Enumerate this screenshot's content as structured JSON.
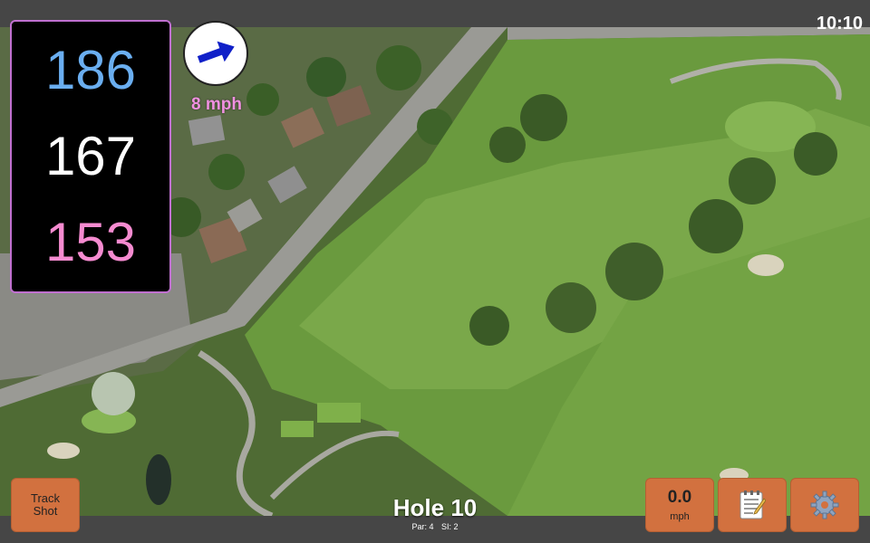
{
  "status_bar": {
    "time": "10:10"
  },
  "distances": {
    "back": "186",
    "middle": "167",
    "front": "153",
    "colors": {
      "back": "#6aaef0",
      "middle": "#ffffff",
      "front": "#f58bd0"
    }
  },
  "wind": {
    "label": "8 mph",
    "arrow_icon": "wind-direction-arrow-icon",
    "arrow_color": "#1020c8",
    "label_color": "#f090e0"
  },
  "hole": {
    "title": "Hole 10",
    "par": "Par: 4",
    "si": "SI: 2"
  },
  "buttons": {
    "track_shot_line1": "Track",
    "track_shot_line2": "Shot",
    "wind_speed_value": "0.0",
    "wind_speed_unit": "mph",
    "notes_icon": "notepad-icon",
    "settings_icon": "gear-icon",
    "button_color": "#d2713f"
  }
}
